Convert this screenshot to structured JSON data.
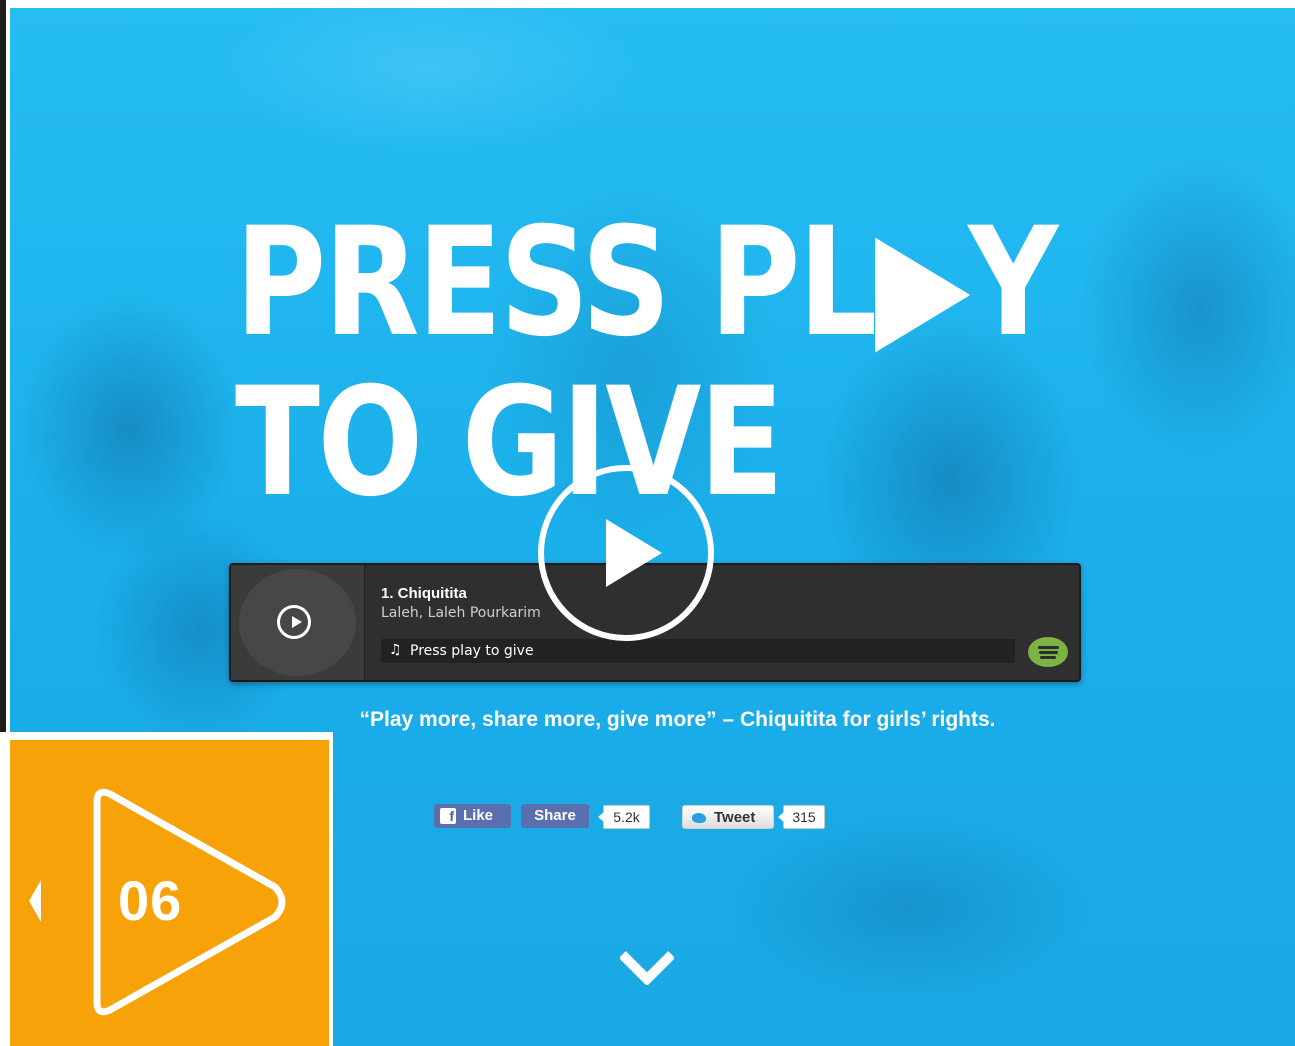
{
  "hero": {
    "headline": [
      "PRESS PL▶Y",
      "TO GIVE"
    ],
    "tagline": "“Play more, share more, give more” – Chiquitita for girls’ rights.",
    "background_color": "#1fb6f0"
  },
  "player": {
    "track_title": "1. Chiquitita",
    "track_artist": "Laleh, Laleh Pourkarim",
    "bar_label": "Press play to give",
    "icons": [
      "play-icon",
      "music-note-icon",
      "spotify-icon"
    ],
    "accent_color": "#7cb342"
  },
  "social": {
    "fb_like_label": "Like",
    "fb_share_label": "Share",
    "fb_count": "5.2k",
    "tweet_label": "Tweet",
    "tweet_count": "315"
  },
  "badge": {
    "number": "06",
    "color": "#f6a208"
  }
}
